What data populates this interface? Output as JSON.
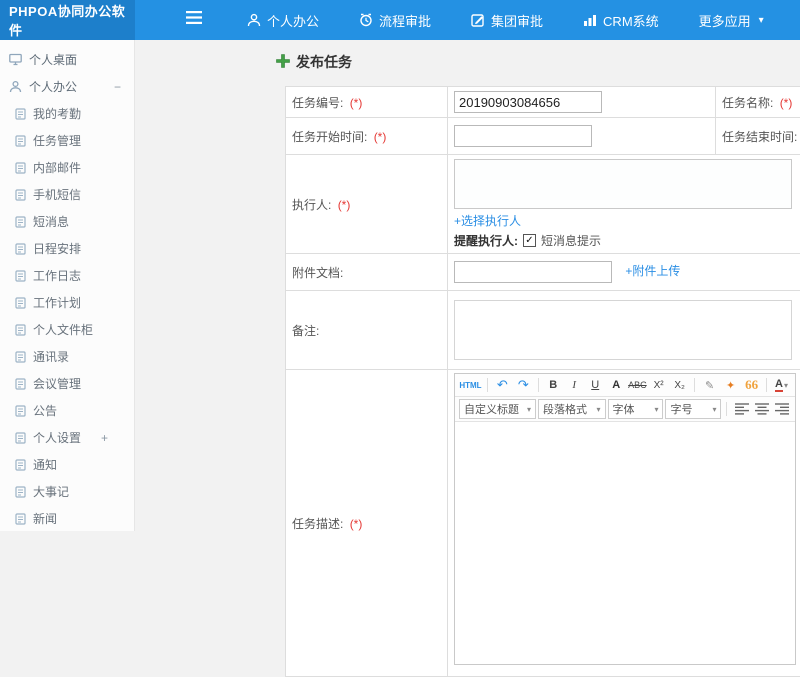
{
  "topbar": {
    "logo": "PHPOA协同办公软件",
    "nav": [
      {
        "label": "个人办公",
        "icon": "user-icon"
      },
      {
        "label": "流程审批",
        "icon": "clock-icon"
      },
      {
        "label": "集团审批",
        "icon": "edit-square-icon"
      },
      {
        "label": "CRM系统",
        "icon": "bar-chart-icon"
      },
      {
        "label": "更多应用",
        "icon": "caret-down-icon"
      }
    ],
    "caret": "▾"
  },
  "sidebar": {
    "items": [
      {
        "label": "个人桌面"
      },
      {
        "label": "个人办公",
        "toggle": "−"
      },
      {
        "label": "我的考勤"
      },
      {
        "label": "任务管理"
      },
      {
        "label": "内部邮件"
      },
      {
        "label": "手机短信"
      },
      {
        "label": "短消息"
      },
      {
        "label": "日程安排"
      },
      {
        "label": "工作日志"
      },
      {
        "label": "工作计划"
      },
      {
        "label": "个人文件柜"
      },
      {
        "label": "通讯录"
      },
      {
        "label": "会议管理"
      },
      {
        "label": "公告"
      },
      {
        "label": "个人设置",
        "toggle": "+"
      },
      {
        "label": "通知"
      },
      {
        "label": "大事记"
      },
      {
        "label": "新闻"
      }
    ]
  },
  "main": {
    "page_title": "发布任务",
    "required_mark": "(*)",
    "form": {
      "task_no": {
        "label": "任务编号:",
        "value": "20190903084656"
      },
      "task_name": {
        "label": "任务名称:"
      },
      "start_time": {
        "label": "任务开始时间:"
      },
      "end_time": {
        "label": "任务结束时间:"
      },
      "executor": {
        "label": "执行人:",
        "choose_link": "+选择执行人",
        "remind_label": "提醒执行人:",
        "check": "✓",
        "sms_option": "短消息提示"
      },
      "attachment": {
        "label": "附件文档:",
        "upload_link": "+附件上传"
      },
      "remark": {
        "label": "备注:"
      },
      "description": {
        "label": "任务描述:"
      }
    },
    "editor": {
      "toolbar1": [
        "HTML",
        "↶",
        "↷",
        "B",
        "I",
        "U",
        "A",
        "ABC",
        "X²",
        "X₂",
        "✎",
        "✦",
        "66",
        "A"
      ],
      "caret": "▾",
      "toolbar2": [
        "自定义标题",
        "段落格式",
        "字体",
        "字号"
      ]
    }
  },
  "colors": {
    "topbar": "#2491e3",
    "logo_bg": "#1d7fcb",
    "link": "#2a8ee4",
    "required": "#e53935",
    "title_plus": "#43a047"
  }
}
